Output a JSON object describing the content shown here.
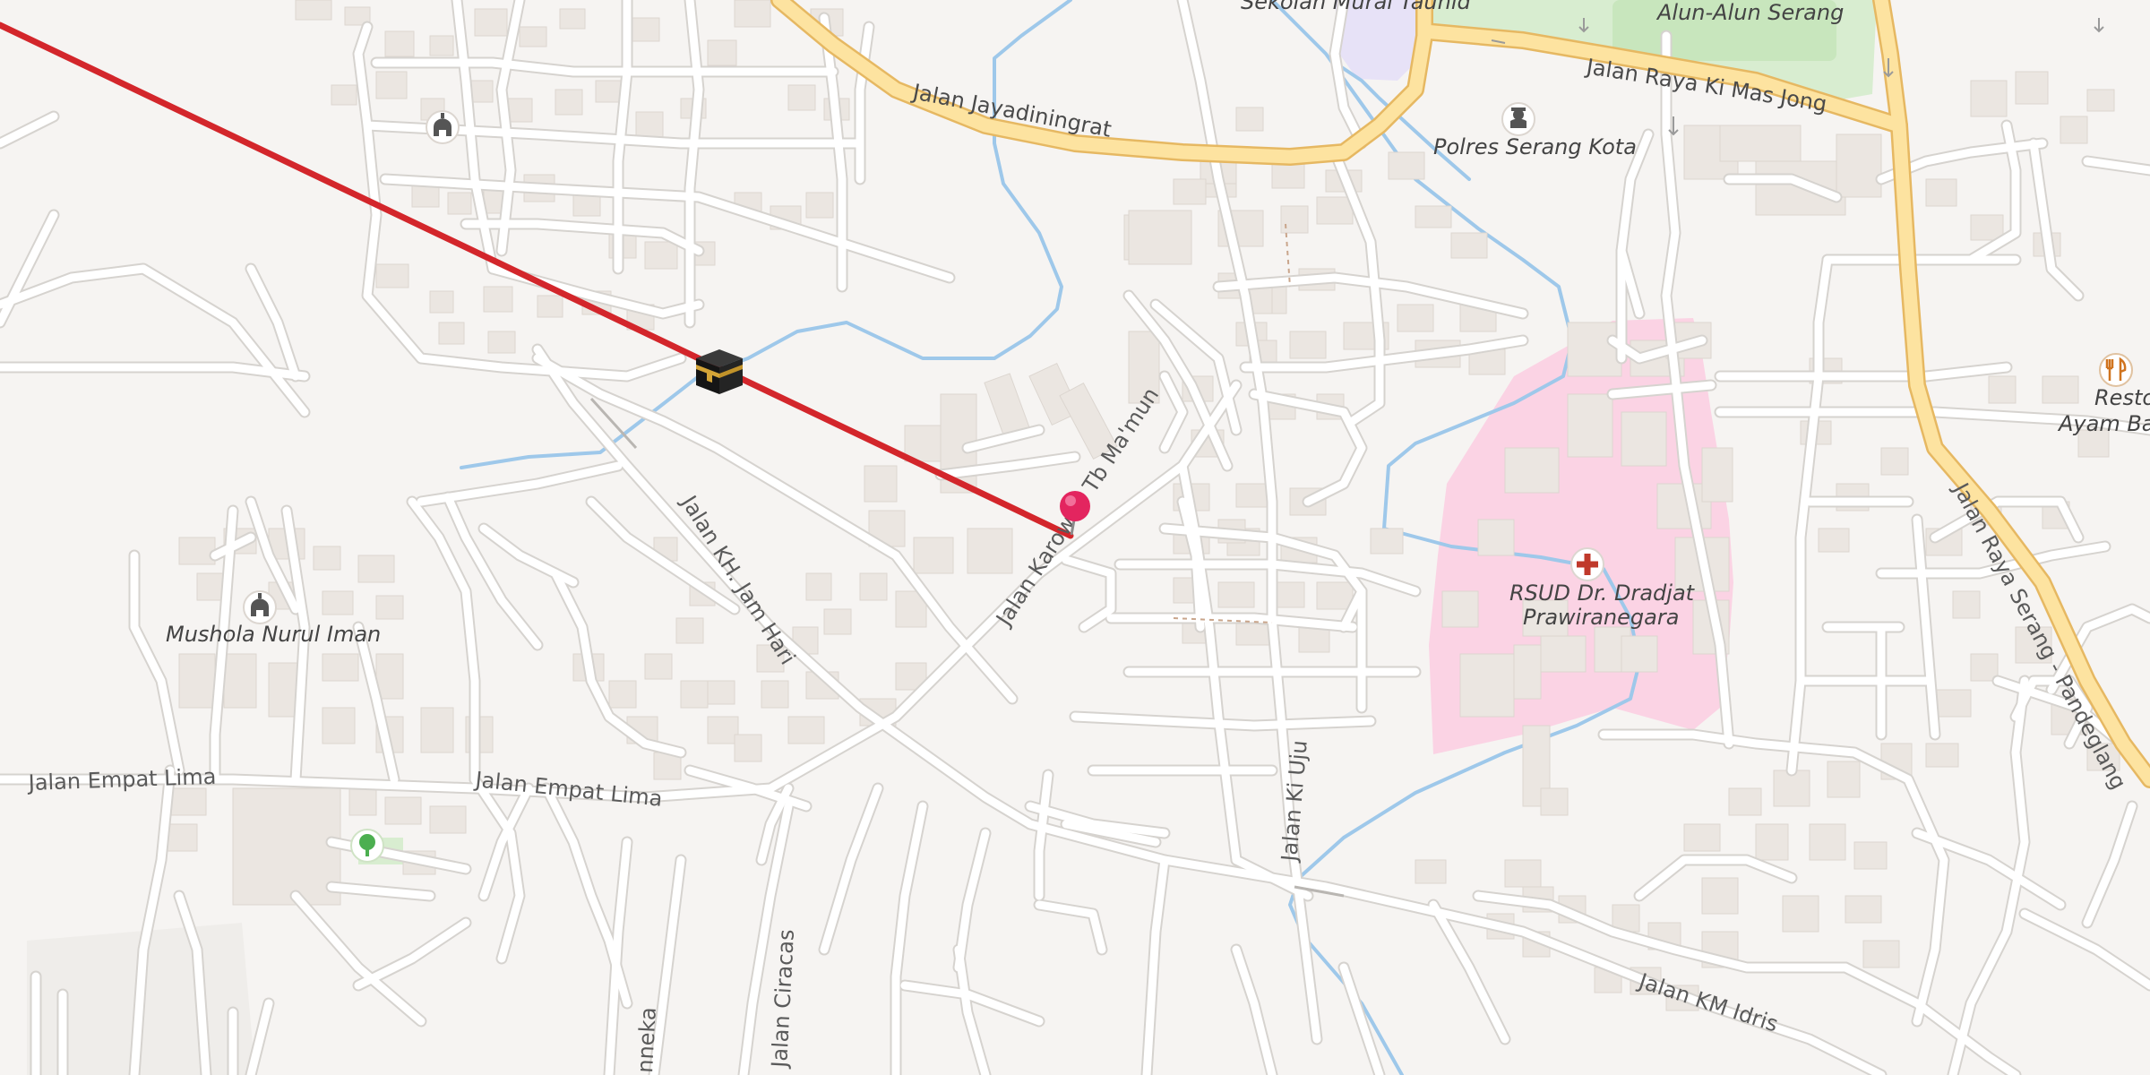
{
  "map": {
    "colors": {
      "background": "#f6f4f2",
      "minor_road": "#ffffff",
      "minor_road_casing": "#d6d3cf",
      "major_road": "#fde3a0",
      "major_road_casing": "#e6b862",
      "building": "#ebe6e1",
      "water": "#9ec8ea",
      "park": "#d8edd0",
      "hospital_area": "#fbd3e4",
      "school_area": "#e7e2f7",
      "qibla_line": "#d3262b",
      "location_pin": "#e3255f"
    },
    "qibla_marker": {
      "icon": "kaaba-icon"
    },
    "location_pin": {
      "icon": "location-pin-icon"
    },
    "pois": [
      {
        "name": "Alun-Alun Serang",
        "icon": ""
      },
      {
        "name": "Sekolah Murai Tauhid",
        "icon": ""
      },
      {
        "name": "Polres Serang Kota",
        "icon": "police-icon"
      },
      {
        "name_line1": "RSUD Dr. Dradjat",
        "name_line2": "Prawiranegara",
        "icon": "hospital-icon"
      },
      {
        "name": "Mushola Nurul Iman",
        "icon": "mosque-icon"
      },
      {
        "name": "",
        "icon": "mosque-icon"
      },
      {
        "name_line1": "Restoran",
        "name_line2": "Ayam Bak",
        "icon": "restaurant-icon"
      },
      {
        "name": "",
        "icon": "park-tree-icon"
      }
    ],
    "road_labels": {
      "jayadiningrat": "Jalan Jayadiningrat",
      "ki_mas_jong": "Jalan Raya Ki Mas Jong",
      "karowan": "Jalan Karowan Tb Ma'mun",
      "jam_hari": "Jalan KH. Jam Hari",
      "empat_lima_a": "Jalan Empat Lima",
      "empat_lima_b": "Jalan Empat Lima",
      "ki_uju": "Jalan Ki Uju",
      "serang_pandeglang": "Jalan Raya Serang - Pandeglang",
      "km_idris": "Jalan KM Idris",
      "ciracas": "Jalan Ciracas",
      "anneka": "nneka"
    }
  }
}
